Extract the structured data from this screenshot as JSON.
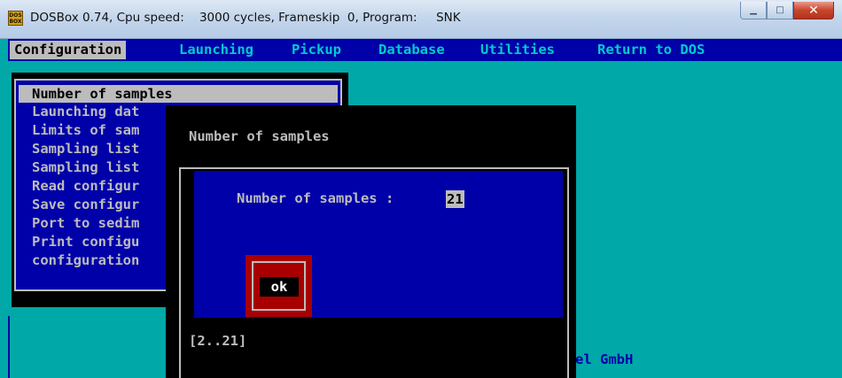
{
  "window": {
    "icon_text": "DOS BOX",
    "title": "DOSBox 0.74, Cpu speed:    3000 cycles, Frameskip  0, Program:     SNK",
    "minimize_glyph": "▁",
    "maximize_glyph": "□",
    "close_glyph": "✕"
  },
  "menu": {
    "items": [
      "Configuration",
      "Launching",
      "Pickup",
      "Database",
      "Utilities",
      "Return to DOS"
    ],
    "active_index": 0
  },
  "config_menu": {
    "items": [
      "Number of samples",
      "Launching dat",
      "Limits of sam",
      "Sampling list",
      "Sampling list",
      "Read configur",
      "Save configur",
      "Port to sedim",
      "Print configu",
      "configuration"
    ],
    "selected_index": 0
  },
  "dialog": {
    "title": "Number of samples",
    "field_label": "Number of samples :",
    "field_value": "21",
    "ok_label": "ok",
    "range_hint": "[2..21]"
  },
  "background": {
    "company_fragment": "el GmbH"
  },
  "colors": {
    "dos_blue": "#0000a8",
    "dos_cyan": "#00a8a8",
    "dos_gray": "#bcbcbc",
    "dos_red": "#a80000"
  }
}
